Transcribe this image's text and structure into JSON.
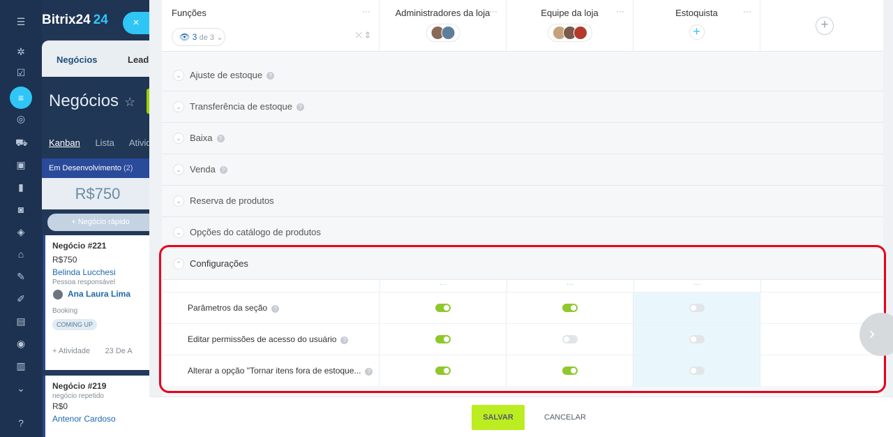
{
  "colors": {
    "accent": "#2fc6f6",
    "toggle_on": "#8fc82a",
    "save_button": "#bbed21",
    "highlight": "#e8001c"
  },
  "app": {
    "brand": "Bitrix24",
    "brand_num": "24",
    "close_icon": "×",
    "tabs": {
      "deals": "Negócios",
      "leads": "Leads"
    },
    "page_title": "Negócios",
    "star": "☆",
    "views": [
      "Kanban",
      "Lista",
      "Ativid"
    ],
    "stage": {
      "name": "Em Desenvolvimento",
      "count": "(2)",
      "sum": "R$750",
      "quick": "+ Negócio rápido"
    },
    "cards": [
      {
        "title": "Negócio #221",
        "amount": "R$750",
        "client": "Belinda Lucchesi",
        "resp_label": "Pessoa responsável",
        "responsible": "Ana Laura Lima",
        "status": "Booking",
        "badge": "COMING UP",
        "activity": "+ Atividade",
        "date": "23 De A"
      },
      {
        "title": "Negócio #219",
        "sub": "negócio repetido",
        "amount": "R$0",
        "client": "Antenor Cardoso"
      }
    ]
  },
  "permissions": {
    "roles_header": "Funções",
    "filter_count": "3",
    "filter_total": "de 3",
    "columns": [
      {
        "name": "Administradores da loja",
        "avatars": [
          "#8a6a55",
          "#5f7e9c"
        ]
      },
      {
        "name": "Equipe da loja",
        "avatars": [
          "#c5a27d",
          "#7a5a48",
          "#b33a2a"
        ]
      },
      {
        "name": "Estoquista",
        "avatars": []
      }
    ],
    "dots": "···",
    "add_role": "+",
    "sections": [
      {
        "label": "Ajuste de estoque",
        "help": true
      },
      {
        "label": "Transferência de estoque",
        "help": true
      },
      {
        "label": "Baixa",
        "help": true
      },
      {
        "label": "Venda",
        "help": true
      },
      {
        "label": "Reserva de produtos",
        "help": false
      },
      {
        "label": "Opções do catálogo de produtos",
        "help": false
      }
    ],
    "expanded_section": "Configurações",
    "rows": [
      {
        "label": "Parâmetros da seção",
        "values": [
          true,
          true,
          false
        ]
      },
      {
        "label": "Editar permissões de acesso do usuário",
        "values": [
          true,
          false,
          false
        ]
      },
      {
        "label": "Alterar a opção \"Tornar itens fora de estoque...",
        "values": [
          true,
          true,
          false
        ]
      }
    ]
  },
  "footer": {
    "save": "SALVAR",
    "cancel": "CANCELAR"
  }
}
